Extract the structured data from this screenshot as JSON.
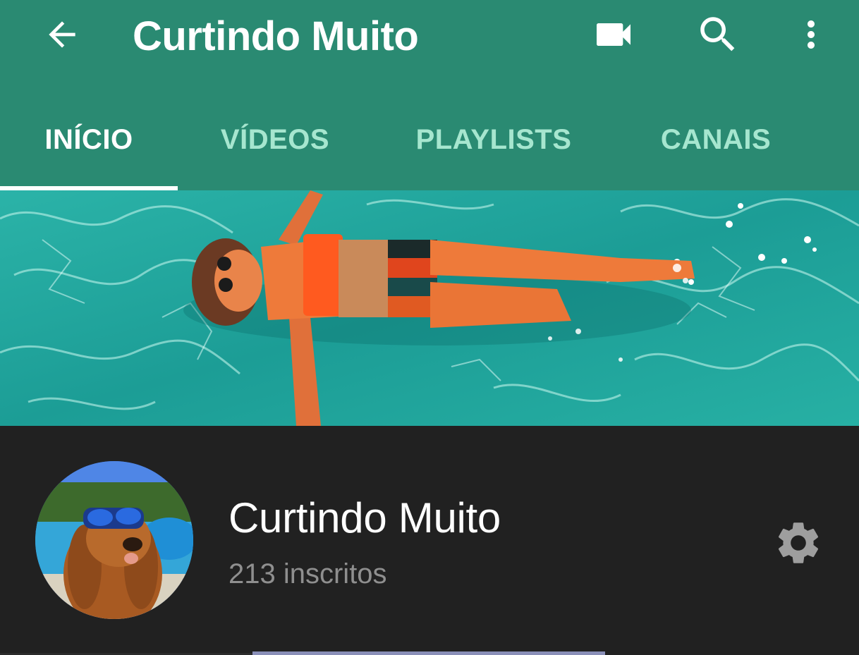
{
  "app_bar": {
    "title": "Curtindo Muito",
    "background_color": "#2a8a72",
    "icons": {
      "back": "arrow-back-icon",
      "video": "videocam-icon",
      "search": "search-icon",
      "more": "more-vert-icon"
    }
  },
  "tabs": [
    {
      "label": "INÍCIO",
      "active": true
    },
    {
      "label": "VÍDEOS",
      "active": false
    },
    {
      "label": "PLAYLISTS",
      "active": false
    },
    {
      "label": "CANAIS",
      "active": false
    }
  ],
  "channel": {
    "name": "Curtindo Muito",
    "subscribers": "213 inscritos",
    "settings_icon": "gear-icon"
  },
  "colors": {
    "accent": "#2a8a72",
    "inactive_tab": "#a6e6cf",
    "dark_background": "#212121",
    "secondary_text": "#8f8f8f"
  }
}
